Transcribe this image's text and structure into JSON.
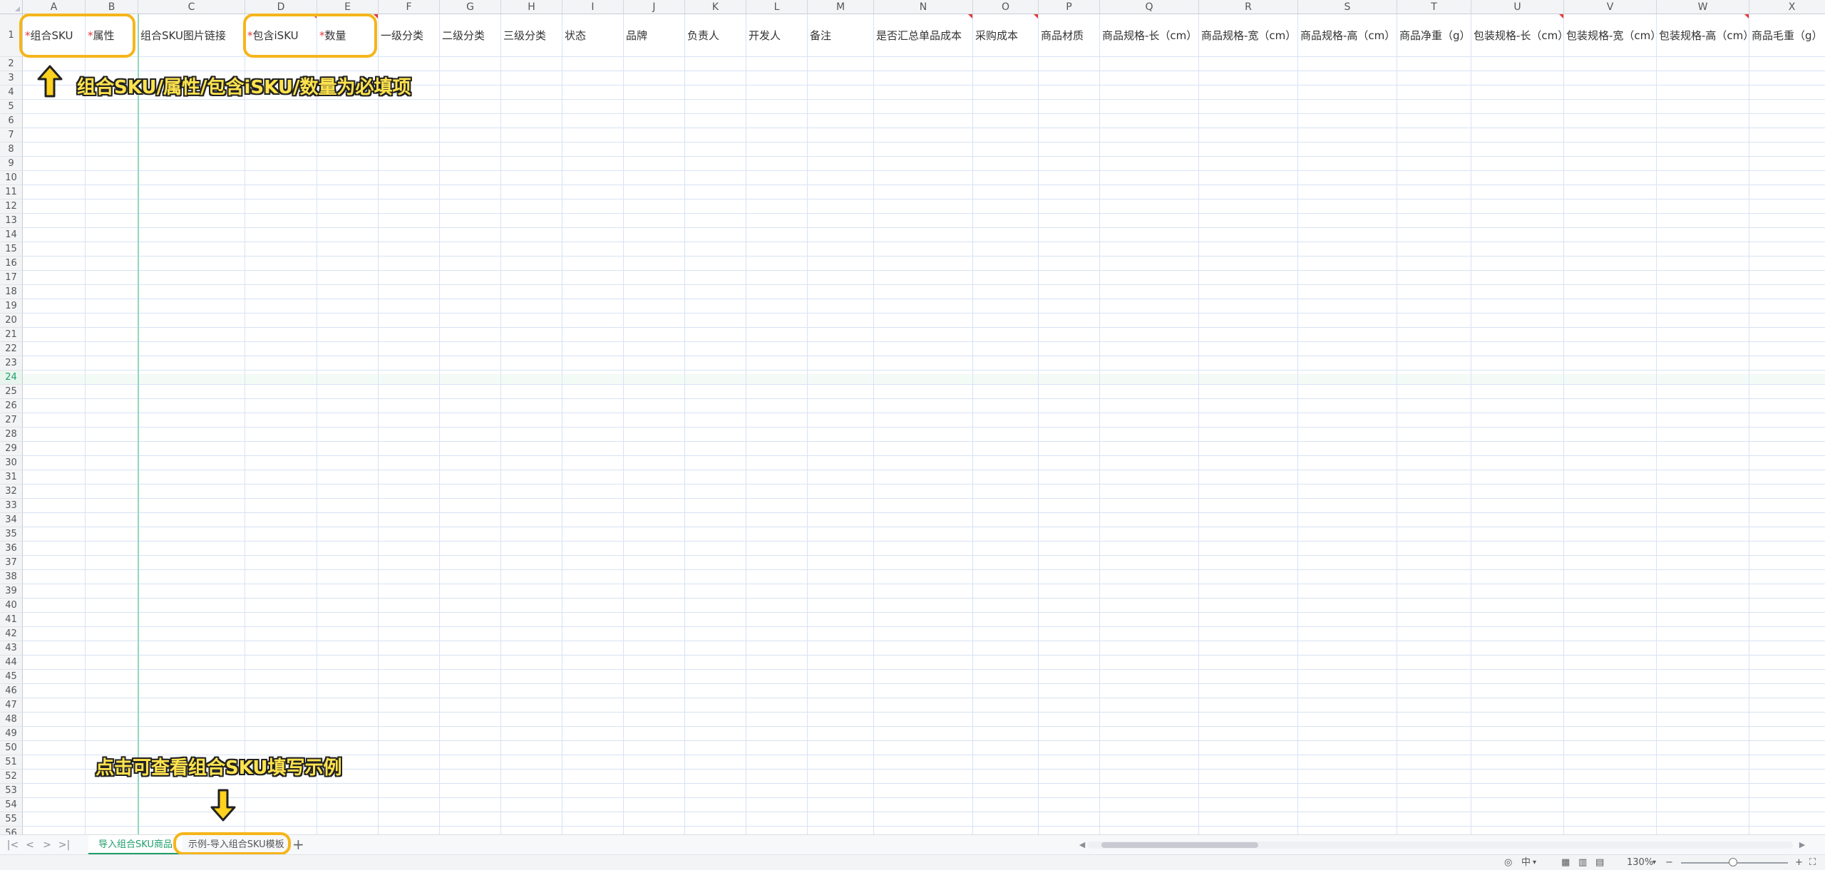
{
  "columns": [
    {
      "letter": "A",
      "header": "组合SKU",
      "required": true
    },
    {
      "letter": "B",
      "header": "属性",
      "required": true
    },
    {
      "letter": "C",
      "header": "组合SKU图片链接",
      "required": false
    },
    {
      "letter": "D",
      "header": "包含iSKU",
      "required": true
    },
    {
      "letter": "E",
      "header": "数量",
      "required": true
    },
    {
      "letter": "F",
      "header": "一级分类",
      "required": false
    },
    {
      "letter": "G",
      "header": "二级分类",
      "required": false
    },
    {
      "letter": "H",
      "header": "三级分类",
      "required": false
    },
    {
      "letter": "I",
      "header": "状态",
      "required": false
    },
    {
      "letter": "J",
      "header": "品牌",
      "required": false
    },
    {
      "letter": "K",
      "header": "负责人",
      "required": false
    },
    {
      "letter": "L",
      "header": "开发人",
      "required": false
    },
    {
      "letter": "M",
      "header": "备注",
      "required": false
    },
    {
      "letter": "N",
      "header": "是否汇总单品成本",
      "required": false
    },
    {
      "letter": "O",
      "header": "采购成本",
      "required": false
    },
    {
      "letter": "P",
      "header": "商品材质",
      "required": false
    },
    {
      "letter": "Q",
      "header": "商品规格-长（cm）",
      "required": false
    },
    {
      "letter": "R",
      "header": "商品规格-宽（cm）",
      "required": false
    },
    {
      "letter": "S",
      "header": "商品规格-高（cm）",
      "required": false
    },
    {
      "letter": "T",
      "header": "商品净重（g）",
      "required": false
    },
    {
      "letter": "U",
      "header": "包装规格-长（cm）",
      "required": false
    },
    {
      "letter": "V",
      "header": "包装规格-宽（cm）",
      "required": false
    },
    {
      "letter": "W",
      "header": "包装规格-高（cm）",
      "required": false
    },
    {
      "letter": "X",
      "header": "商品毛重（g）",
      "required": false
    }
  ],
  "required_marker": "*",
  "row_numbers": [
    1,
    2,
    3,
    4,
    5,
    6,
    7,
    8,
    9,
    10,
    11,
    12,
    13,
    14,
    15,
    16,
    17,
    18,
    19,
    20,
    21,
    22,
    23,
    24,
    25,
    26,
    27,
    28,
    29,
    30,
    31,
    32,
    33,
    34,
    35,
    36,
    37,
    38,
    39,
    40,
    41,
    42,
    43,
    44,
    45,
    46,
    47,
    48,
    49,
    50,
    51,
    52,
    53,
    54,
    55,
    56
  ],
  "active_row": 24,
  "annotations": {
    "required_note": "组合SKU/属性/包含iSKU/数量为必填项",
    "example_note": "点击可查看组合SKU填写示例"
  },
  "sheet_tabs": [
    {
      "label": "导入组合SKU商品",
      "active": true
    },
    {
      "label": "示例-导入组合SKU模板",
      "active": false
    }
  ],
  "tab_nav": [
    "|<",
    "<",
    ">",
    ">|"
  ],
  "status_bar": {
    "input_mode": "中",
    "zoom": "130%",
    "zoom_minus": "−",
    "zoom_plus": "+"
  },
  "colors": {
    "accent_green": "#1e9e6a",
    "highlight_orange": "#f5b51b",
    "required_red": "#e53935",
    "annotation_yellow": "#ffe34d"
  }
}
